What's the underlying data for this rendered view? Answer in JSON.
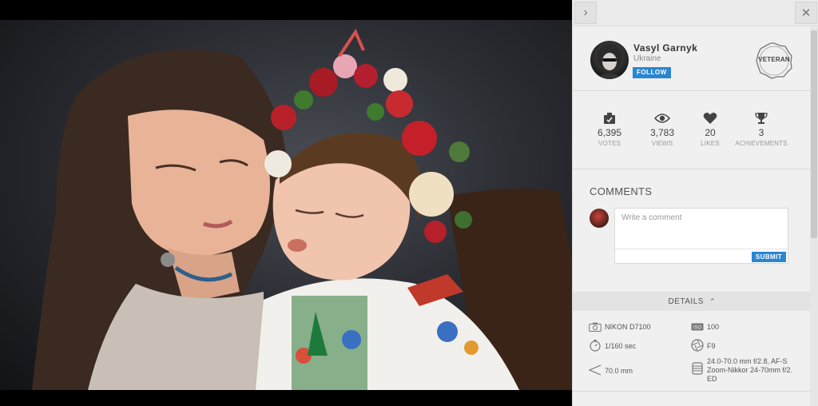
{
  "panel": {
    "collapse_icon": "chevron-right-icon",
    "close_icon": "close-icon"
  },
  "author": {
    "name": "Vasyl Garnyk",
    "country": "Ukraine",
    "follow_label": "FOLLOW",
    "badge_label": "VETERAN"
  },
  "stats": [
    {
      "icon": "votes-icon",
      "value": "6,395",
      "label": "VOTES"
    },
    {
      "icon": "eye-icon",
      "value": "3,783",
      "label": "VIEWS"
    },
    {
      "icon": "heart-icon",
      "value": "20",
      "label": "LIKES"
    },
    {
      "icon": "trophy-icon",
      "value": "3",
      "label": "ACHIEVEMENTS"
    }
  ],
  "comments": {
    "title": "COMMENTS",
    "placeholder": "Write a comment",
    "submit_label": "SUBMIT"
  },
  "details": {
    "label": "DETAILS",
    "camera": "NIKON D7100",
    "iso": "100",
    "shutter": "1/160 sec",
    "aperture": "F9",
    "focal_length": "70.0 mm",
    "lens": "24.0-70.0 mm f/2.8, AF-S Zoom-Nikkor 24-70mm f/2. ED"
  },
  "colors": {
    "accent": "#2a86d1",
    "panel_bg": "#f0f0f0"
  }
}
